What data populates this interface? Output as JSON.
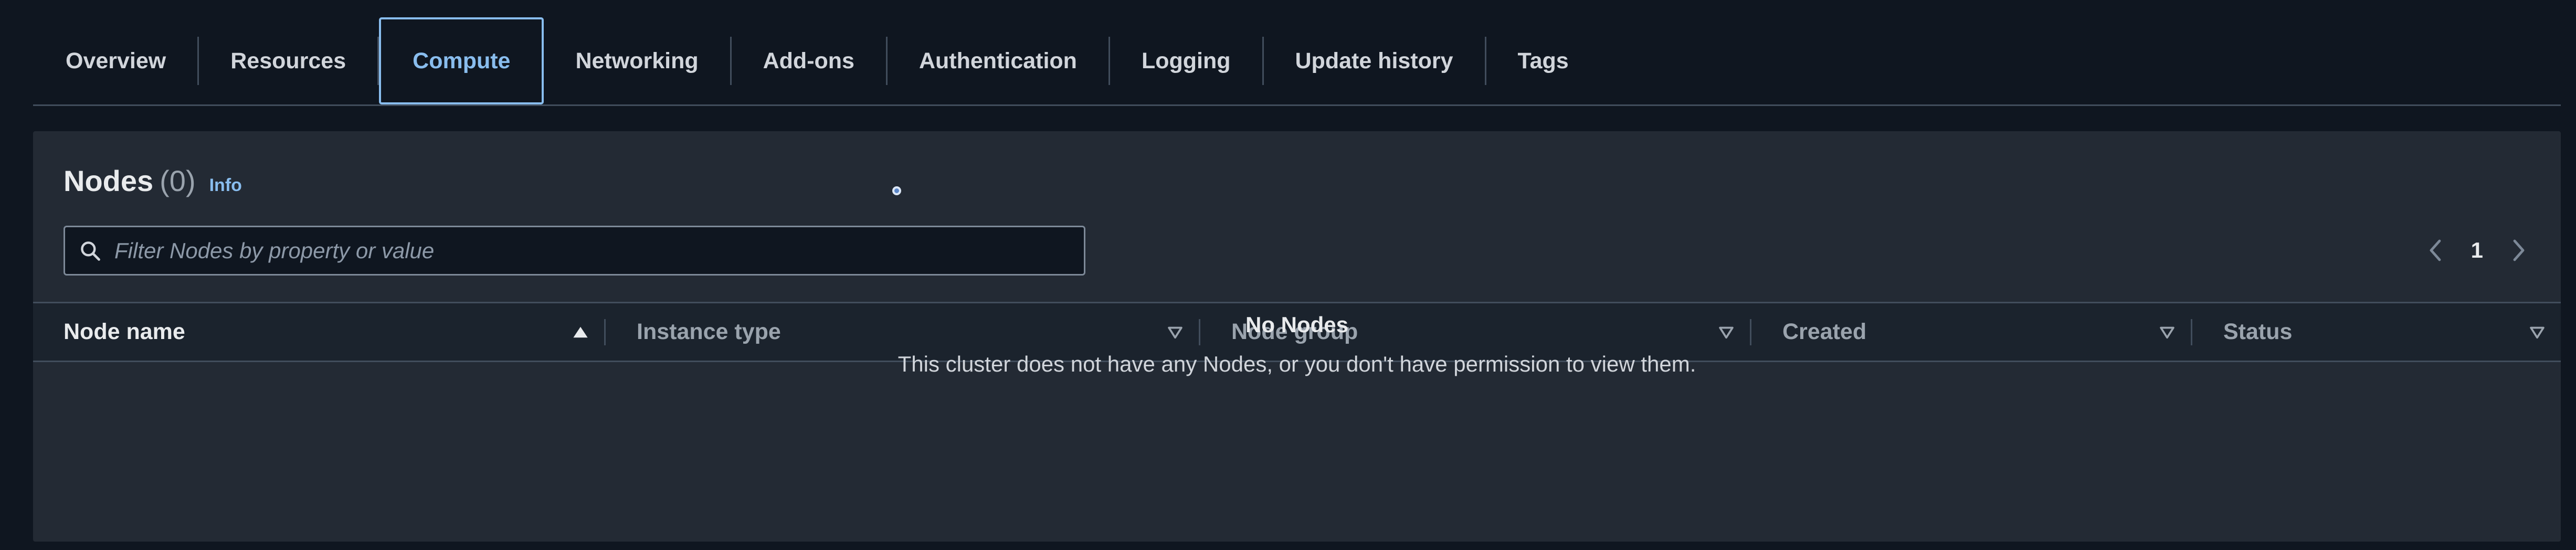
{
  "tabs": {
    "items": [
      {
        "label": "Overview"
      },
      {
        "label": "Resources"
      },
      {
        "label": "Compute"
      },
      {
        "label": "Networking"
      },
      {
        "label": "Add-ons"
      },
      {
        "label": "Authentication"
      },
      {
        "label": "Logging"
      },
      {
        "label": "Update history"
      },
      {
        "label": "Tags"
      }
    ],
    "active": "Compute"
  },
  "nodes": {
    "title": "Nodes",
    "count": "(0)",
    "info_link": "Info",
    "filter": {
      "placeholder": "Filter Nodes by property or value",
      "value": ""
    },
    "pagination": {
      "current_page": "1"
    },
    "columns": [
      {
        "label": "Node name",
        "sort": "ascending"
      },
      {
        "label": "Instance type",
        "sort": "none"
      },
      {
        "label": "Node group",
        "sort": "none"
      },
      {
        "label": "Created",
        "sort": "none"
      },
      {
        "label": "Status",
        "sort": "none"
      }
    ],
    "empty_state": {
      "title": "No Nodes",
      "description": "This cluster does not have any Nodes, or you don't have permission to view them."
    }
  },
  "colors": {
    "background": "#0f1620",
    "panel": "#232a34",
    "accent": "#89bdee",
    "divider": "#414d5c"
  }
}
